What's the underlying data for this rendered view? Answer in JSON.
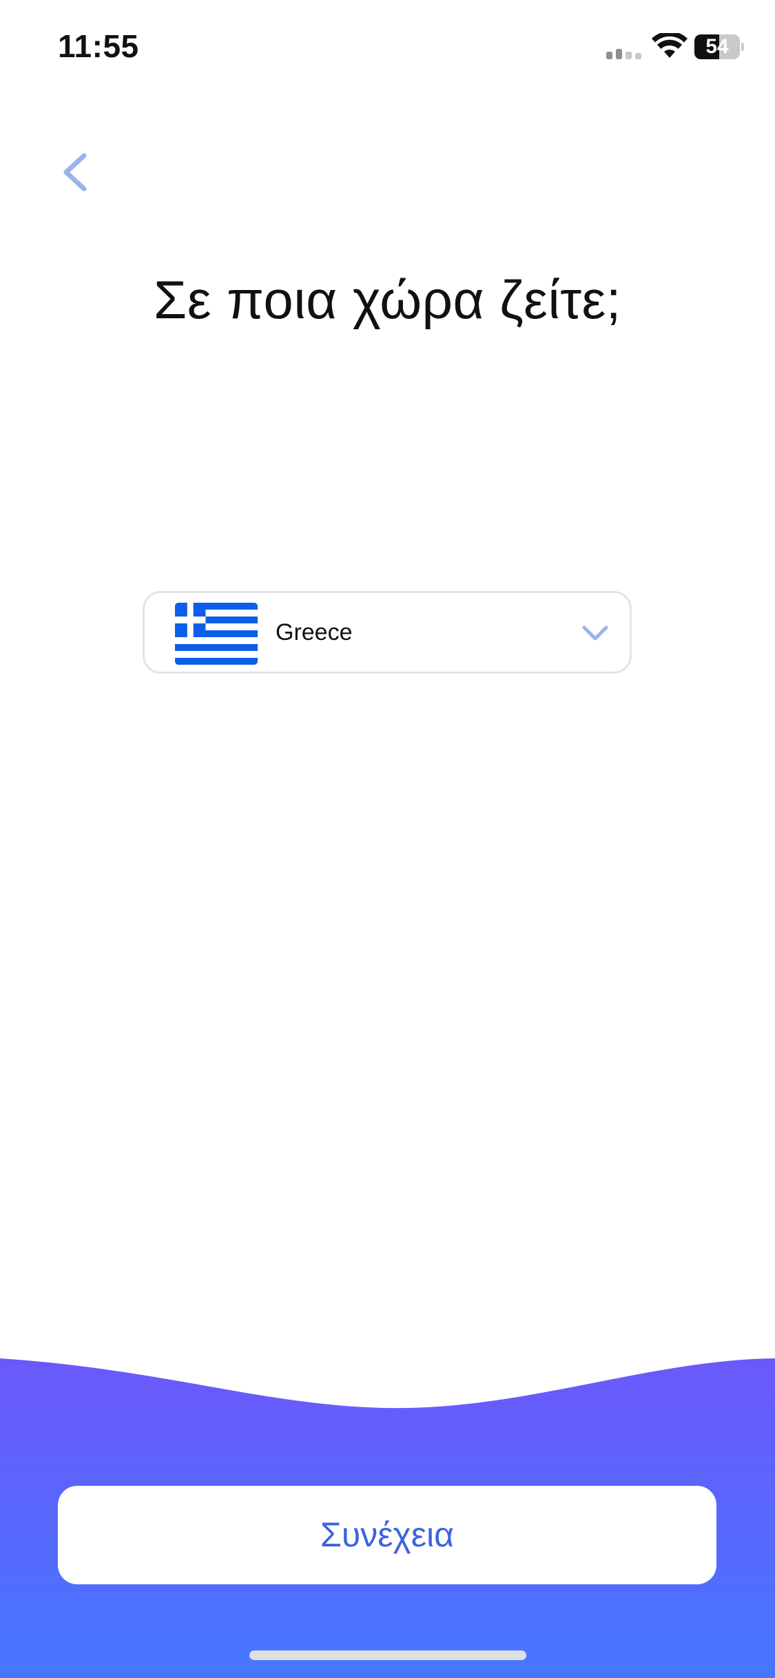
{
  "status_bar": {
    "time": "11:55",
    "battery_level": "54",
    "battery_fraction": 0.54
  },
  "header": {
    "back_icon": "chevron-left-icon"
  },
  "title": "Σε ποια χώρα ζείτε;",
  "country_select": {
    "flag_icon": "greece-flag-icon",
    "value": "Greece",
    "dropdown_icon": "chevron-down-icon"
  },
  "footer": {
    "continue_label": "Συνέχεια"
  },
  "colors": {
    "accent": "#3d63de",
    "wave_top": "#6b58fb",
    "wave_bottom": "#4677ff",
    "icon_light_blue": "#9bb2ee",
    "flag_blue": "#0d5eeb"
  }
}
